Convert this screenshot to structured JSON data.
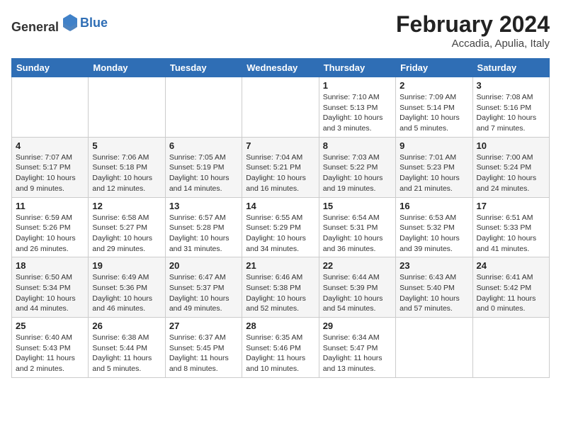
{
  "header": {
    "logo_general": "General",
    "logo_blue": "Blue",
    "month_year": "February 2024",
    "location": "Accadia, Apulia, Italy"
  },
  "columns": [
    "Sunday",
    "Monday",
    "Tuesday",
    "Wednesday",
    "Thursday",
    "Friday",
    "Saturday"
  ],
  "weeks": [
    [
      {
        "day": "",
        "info": ""
      },
      {
        "day": "",
        "info": ""
      },
      {
        "day": "",
        "info": ""
      },
      {
        "day": "",
        "info": ""
      },
      {
        "day": "1",
        "info": "Sunrise: 7:10 AM\nSunset: 5:13 PM\nDaylight: 10 hours\nand 3 minutes."
      },
      {
        "day": "2",
        "info": "Sunrise: 7:09 AM\nSunset: 5:14 PM\nDaylight: 10 hours\nand 5 minutes."
      },
      {
        "day": "3",
        "info": "Sunrise: 7:08 AM\nSunset: 5:16 PM\nDaylight: 10 hours\nand 7 minutes."
      }
    ],
    [
      {
        "day": "4",
        "info": "Sunrise: 7:07 AM\nSunset: 5:17 PM\nDaylight: 10 hours\nand 9 minutes."
      },
      {
        "day": "5",
        "info": "Sunrise: 7:06 AM\nSunset: 5:18 PM\nDaylight: 10 hours\nand 12 minutes."
      },
      {
        "day": "6",
        "info": "Sunrise: 7:05 AM\nSunset: 5:19 PM\nDaylight: 10 hours\nand 14 minutes."
      },
      {
        "day": "7",
        "info": "Sunrise: 7:04 AM\nSunset: 5:21 PM\nDaylight: 10 hours\nand 16 minutes."
      },
      {
        "day": "8",
        "info": "Sunrise: 7:03 AM\nSunset: 5:22 PM\nDaylight: 10 hours\nand 19 minutes."
      },
      {
        "day": "9",
        "info": "Sunrise: 7:01 AM\nSunset: 5:23 PM\nDaylight: 10 hours\nand 21 minutes."
      },
      {
        "day": "10",
        "info": "Sunrise: 7:00 AM\nSunset: 5:24 PM\nDaylight: 10 hours\nand 24 minutes."
      }
    ],
    [
      {
        "day": "11",
        "info": "Sunrise: 6:59 AM\nSunset: 5:26 PM\nDaylight: 10 hours\nand 26 minutes."
      },
      {
        "day": "12",
        "info": "Sunrise: 6:58 AM\nSunset: 5:27 PM\nDaylight: 10 hours\nand 29 minutes."
      },
      {
        "day": "13",
        "info": "Sunrise: 6:57 AM\nSunset: 5:28 PM\nDaylight: 10 hours\nand 31 minutes."
      },
      {
        "day": "14",
        "info": "Sunrise: 6:55 AM\nSunset: 5:29 PM\nDaylight: 10 hours\nand 34 minutes."
      },
      {
        "day": "15",
        "info": "Sunrise: 6:54 AM\nSunset: 5:31 PM\nDaylight: 10 hours\nand 36 minutes."
      },
      {
        "day": "16",
        "info": "Sunrise: 6:53 AM\nSunset: 5:32 PM\nDaylight: 10 hours\nand 39 minutes."
      },
      {
        "day": "17",
        "info": "Sunrise: 6:51 AM\nSunset: 5:33 PM\nDaylight: 10 hours\nand 41 minutes."
      }
    ],
    [
      {
        "day": "18",
        "info": "Sunrise: 6:50 AM\nSunset: 5:34 PM\nDaylight: 10 hours\nand 44 minutes."
      },
      {
        "day": "19",
        "info": "Sunrise: 6:49 AM\nSunset: 5:36 PM\nDaylight: 10 hours\nand 46 minutes."
      },
      {
        "day": "20",
        "info": "Sunrise: 6:47 AM\nSunset: 5:37 PM\nDaylight: 10 hours\nand 49 minutes."
      },
      {
        "day": "21",
        "info": "Sunrise: 6:46 AM\nSunset: 5:38 PM\nDaylight: 10 hours\nand 52 minutes."
      },
      {
        "day": "22",
        "info": "Sunrise: 6:44 AM\nSunset: 5:39 PM\nDaylight: 10 hours\nand 54 minutes."
      },
      {
        "day": "23",
        "info": "Sunrise: 6:43 AM\nSunset: 5:40 PM\nDaylight: 10 hours\nand 57 minutes."
      },
      {
        "day": "24",
        "info": "Sunrise: 6:41 AM\nSunset: 5:42 PM\nDaylight: 11 hours\nand 0 minutes."
      }
    ],
    [
      {
        "day": "25",
        "info": "Sunrise: 6:40 AM\nSunset: 5:43 PM\nDaylight: 11 hours\nand 2 minutes."
      },
      {
        "day": "26",
        "info": "Sunrise: 6:38 AM\nSunset: 5:44 PM\nDaylight: 11 hours\nand 5 minutes."
      },
      {
        "day": "27",
        "info": "Sunrise: 6:37 AM\nSunset: 5:45 PM\nDaylight: 11 hours\nand 8 minutes."
      },
      {
        "day": "28",
        "info": "Sunrise: 6:35 AM\nSunset: 5:46 PM\nDaylight: 11 hours\nand 10 minutes."
      },
      {
        "day": "29",
        "info": "Sunrise: 6:34 AM\nSunset: 5:47 PM\nDaylight: 11 hours\nand 13 minutes."
      },
      {
        "day": "",
        "info": ""
      },
      {
        "day": "",
        "info": ""
      }
    ]
  ]
}
